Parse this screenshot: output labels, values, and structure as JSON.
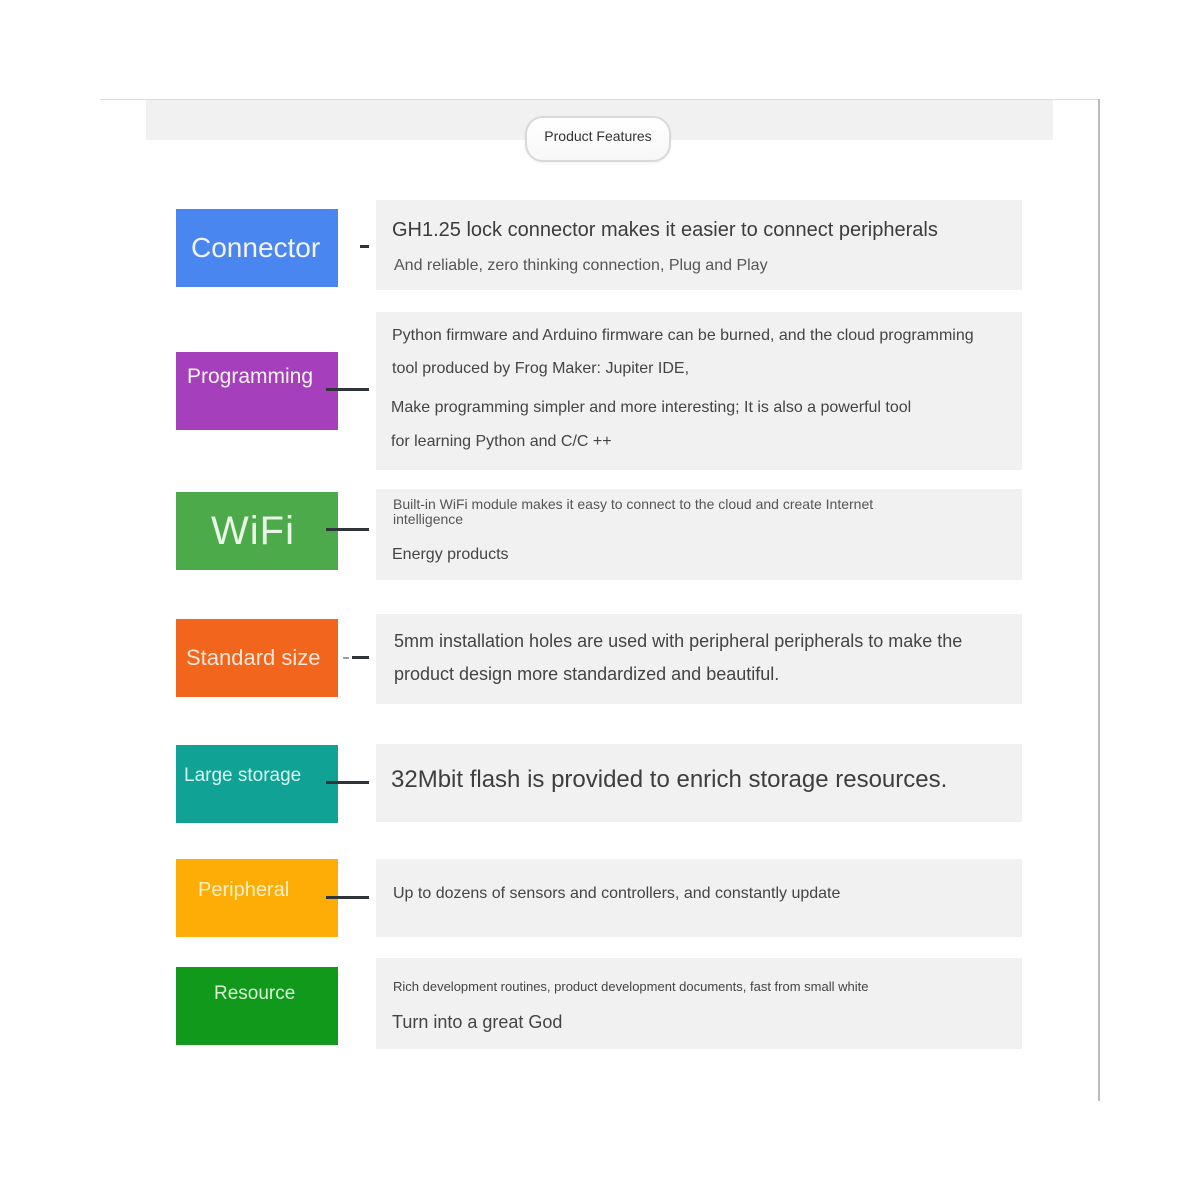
{
  "title": "Product Features",
  "features": [
    {
      "name": "Connector",
      "color": "#4a86f0",
      "lines": [
        "GH1.25 lock connector makes it easier to connect peripherals",
        "And reliable, zero thinking connection, Plug and Play"
      ]
    },
    {
      "name": "Programming",
      "color": "#a63fbb",
      "lines": [
        "Python firmware and Arduino firmware can be burned, and the cloud programming",
        "tool produced by Frog Maker: Jupiter IDE,",
        "Make programming simpler and more interesting; It is also a powerful tool",
        "for learning Python and C/C ++"
      ]
    },
    {
      "name": "WiFi",
      "color": "#4caa4a",
      "lines": [
        "Built-in WiFi module makes it easy to connect to the cloud and create Internet",
        "intelligence",
        "Energy products"
      ]
    },
    {
      "name": "Standard size",
      "color": "#f1661c",
      "lines": [
        "5mm installation holes are used with peripheral peripherals to make the",
        "product design more standardized and beautiful."
      ]
    },
    {
      "name": "Large storage",
      "color": "#11a296",
      "lines": [
        "32Mbit flash is provided to enrich storage resources."
      ]
    },
    {
      "name": "Peripheral",
      "color": "#fdad05",
      "lines": [
        "Up to dozens of sensors and controllers, and constantly update"
      ]
    },
    {
      "name": "Resource",
      "color": "#10991a",
      "lines": [
        "Rich development routines, product development documents, fast from small white",
        "Turn into a great God"
      ]
    }
  ]
}
